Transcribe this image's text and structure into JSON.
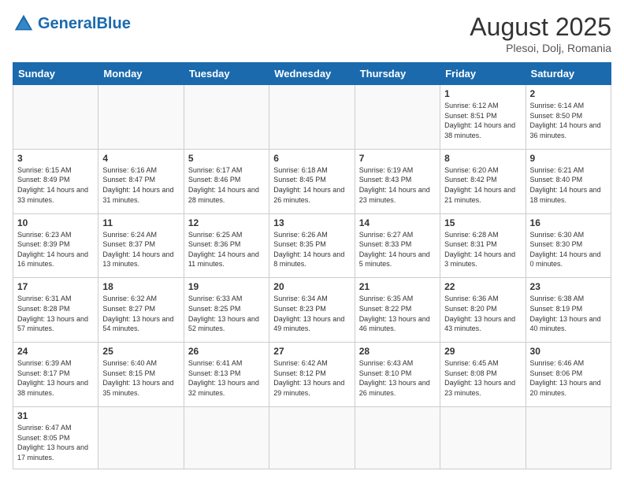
{
  "logo": {
    "text_general": "General",
    "text_blue": "Blue"
  },
  "title": "August 2025",
  "subtitle": "Plesoi, Dolj, Romania",
  "days_of_week": [
    "Sunday",
    "Monday",
    "Tuesday",
    "Wednesday",
    "Thursday",
    "Friday",
    "Saturday"
  ],
  "weeks": [
    [
      {
        "day": "",
        "info": ""
      },
      {
        "day": "",
        "info": ""
      },
      {
        "day": "",
        "info": ""
      },
      {
        "day": "",
        "info": ""
      },
      {
        "day": "",
        "info": ""
      },
      {
        "day": "1",
        "info": "Sunrise: 6:12 AM\nSunset: 8:51 PM\nDaylight: 14 hours and 38 minutes."
      },
      {
        "day": "2",
        "info": "Sunrise: 6:14 AM\nSunset: 8:50 PM\nDaylight: 14 hours and 36 minutes."
      }
    ],
    [
      {
        "day": "3",
        "info": "Sunrise: 6:15 AM\nSunset: 8:49 PM\nDaylight: 14 hours and 33 minutes."
      },
      {
        "day": "4",
        "info": "Sunrise: 6:16 AM\nSunset: 8:47 PM\nDaylight: 14 hours and 31 minutes."
      },
      {
        "day": "5",
        "info": "Sunrise: 6:17 AM\nSunset: 8:46 PM\nDaylight: 14 hours and 28 minutes."
      },
      {
        "day": "6",
        "info": "Sunrise: 6:18 AM\nSunset: 8:45 PM\nDaylight: 14 hours and 26 minutes."
      },
      {
        "day": "7",
        "info": "Sunrise: 6:19 AM\nSunset: 8:43 PM\nDaylight: 14 hours and 23 minutes."
      },
      {
        "day": "8",
        "info": "Sunrise: 6:20 AM\nSunset: 8:42 PM\nDaylight: 14 hours and 21 minutes."
      },
      {
        "day": "9",
        "info": "Sunrise: 6:21 AM\nSunset: 8:40 PM\nDaylight: 14 hours and 18 minutes."
      }
    ],
    [
      {
        "day": "10",
        "info": "Sunrise: 6:23 AM\nSunset: 8:39 PM\nDaylight: 14 hours and 16 minutes."
      },
      {
        "day": "11",
        "info": "Sunrise: 6:24 AM\nSunset: 8:37 PM\nDaylight: 14 hours and 13 minutes."
      },
      {
        "day": "12",
        "info": "Sunrise: 6:25 AM\nSunset: 8:36 PM\nDaylight: 14 hours and 11 minutes."
      },
      {
        "day": "13",
        "info": "Sunrise: 6:26 AM\nSunset: 8:35 PM\nDaylight: 14 hours and 8 minutes."
      },
      {
        "day": "14",
        "info": "Sunrise: 6:27 AM\nSunset: 8:33 PM\nDaylight: 14 hours and 5 minutes."
      },
      {
        "day": "15",
        "info": "Sunrise: 6:28 AM\nSunset: 8:31 PM\nDaylight: 14 hours and 3 minutes."
      },
      {
        "day": "16",
        "info": "Sunrise: 6:30 AM\nSunset: 8:30 PM\nDaylight: 14 hours and 0 minutes."
      }
    ],
    [
      {
        "day": "17",
        "info": "Sunrise: 6:31 AM\nSunset: 8:28 PM\nDaylight: 13 hours and 57 minutes."
      },
      {
        "day": "18",
        "info": "Sunrise: 6:32 AM\nSunset: 8:27 PM\nDaylight: 13 hours and 54 minutes."
      },
      {
        "day": "19",
        "info": "Sunrise: 6:33 AM\nSunset: 8:25 PM\nDaylight: 13 hours and 52 minutes."
      },
      {
        "day": "20",
        "info": "Sunrise: 6:34 AM\nSunset: 8:23 PM\nDaylight: 13 hours and 49 minutes."
      },
      {
        "day": "21",
        "info": "Sunrise: 6:35 AM\nSunset: 8:22 PM\nDaylight: 13 hours and 46 minutes."
      },
      {
        "day": "22",
        "info": "Sunrise: 6:36 AM\nSunset: 8:20 PM\nDaylight: 13 hours and 43 minutes."
      },
      {
        "day": "23",
        "info": "Sunrise: 6:38 AM\nSunset: 8:19 PM\nDaylight: 13 hours and 40 minutes."
      }
    ],
    [
      {
        "day": "24",
        "info": "Sunrise: 6:39 AM\nSunset: 8:17 PM\nDaylight: 13 hours and 38 minutes."
      },
      {
        "day": "25",
        "info": "Sunrise: 6:40 AM\nSunset: 8:15 PM\nDaylight: 13 hours and 35 minutes."
      },
      {
        "day": "26",
        "info": "Sunrise: 6:41 AM\nSunset: 8:13 PM\nDaylight: 13 hours and 32 minutes."
      },
      {
        "day": "27",
        "info": "Sunrise: 6:42 AM\nSunset: 8:12 PM\nDaylight: 13 hours and 29 minutes."
      },
      {
        "day": "28",
        "info": "Sunrise: 6:43 AM\nSunset: 8:10 PM\nDaylight: 13 hours and 26 minutes."
      },
      {
        "day": "29",
        "info": "Sunrise: 6:45 AM\nSunset: 8:08 PM\nDaylight: 13 hours and 23 minutes."
      },
      {
        "day": "30",
        "info": "Sunrise: 6:46 AM\nSunset: 8:06 PM\nDaylight: 13 hours and 20 minutes."
      }
    ],
    [
      {
        "day": "31",
        "info": "Sunrise: 6:47 AM\nSunset: 8:05 PM\nDaylight: 13 hours and 17 minutes."
      },
      {
        "day": "",
        "info": ""
      },
      {
        "day": "",
        "info": ""
      },
      {
        "day": "",
        "info": ""
      },
      {
        "day": "",
        "info": ""
      },
      {
        "day": "",
        "info": ""
      },
      {
        "day": "",
        "info": ""
      }
    ]
  ]
}
